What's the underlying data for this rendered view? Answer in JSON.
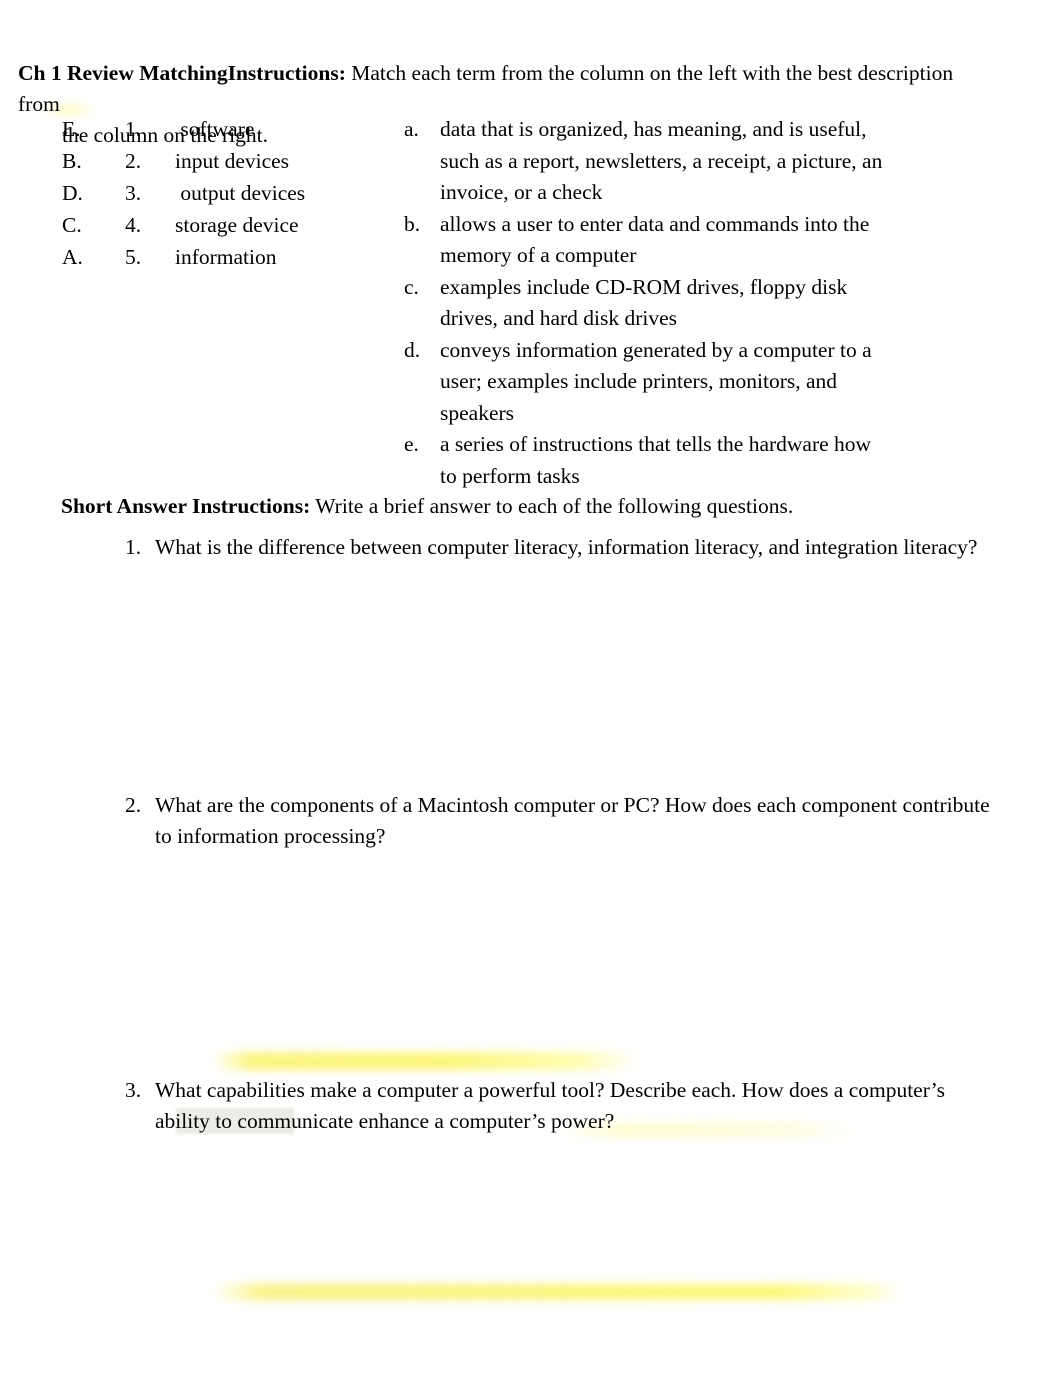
{
  "document": {
    "heading": {
      "bold_lead": "Ch 1  Review MatchingInstructions:",
      "body": " Match each term from the column on the left with the best description from",
      "continuation": "the column on the right."
    },
    "matching": {
      "left_column": [
        {
          "answer": "E.",
          "number": "1.",
          "term": " software"
        },
        {
          "answer": "B.",
          "number": "2.",
          "term": "input devices"
        },
        {
          "answer": "D.",
          "number": "3.",
          "term": " output devices"
        },
        {
          "answer": "C.",
          "number": "4.",
          "term": "storage device"
        },
        {
          "answer": "A.",
          "number": "5.",
          "term": "information"
        }
      ],
      "right_column": [
        {
          "letter": "a.",
          "lines": [
            "data that is organized, has meaning, and is useful,",
            "such as a report, newsletters, a receipt, a picture, an",
            "invoice, or a check"
          ]
        },
        {
          "letter": "b.",
          "lines": [
            "allows a user to enter data and commands into the",
            "memory of a computer"
          ]
        },
        {
          "letter": "c.",
          "lines": [
            "examples include CD-ROM drives, floppy disk",
            "drives, and hard disk drives"
          ]
        },
        {
          "letter": "d.",
          "lines": [
            "conveys information generated by a computer to a",
            "user; examples include printers, monitors, and",
            "speakers"
          ]
        },
        {
          "letter": "e.",
          "lines": [
            "a series of instructions that tells the hardware how",
            "to perform tasks"
          ]
        }
      ]
    },
    "short_answer": {
      "bold_lead": "Short Answer Instructions:",
      "body": " Write a brief answer to each of the following questions.",
      "questions": [
        {
          "number": "1.",
          "text": "What is the difference between computer literacy, information literacy, and integration literacy?"
        },
        {
          "number": "2.",
          "text": "What are the components of a Macintosh computer or PC? How does each component contribute to information processing?"
        },
        {
          "number": "3.",
          "text": "What capabilities make a computer a powerful tool? Describe each. How does a computer’s ability to communicate enhance a computer’s power?"
        }
      ]
    },
    "annotations": {
      "highlight_color": "#f8f178",
      "faint_highlight_color": "#fffbd2",
      "shading_color": "#e9e7e2"
    }
  }
}
